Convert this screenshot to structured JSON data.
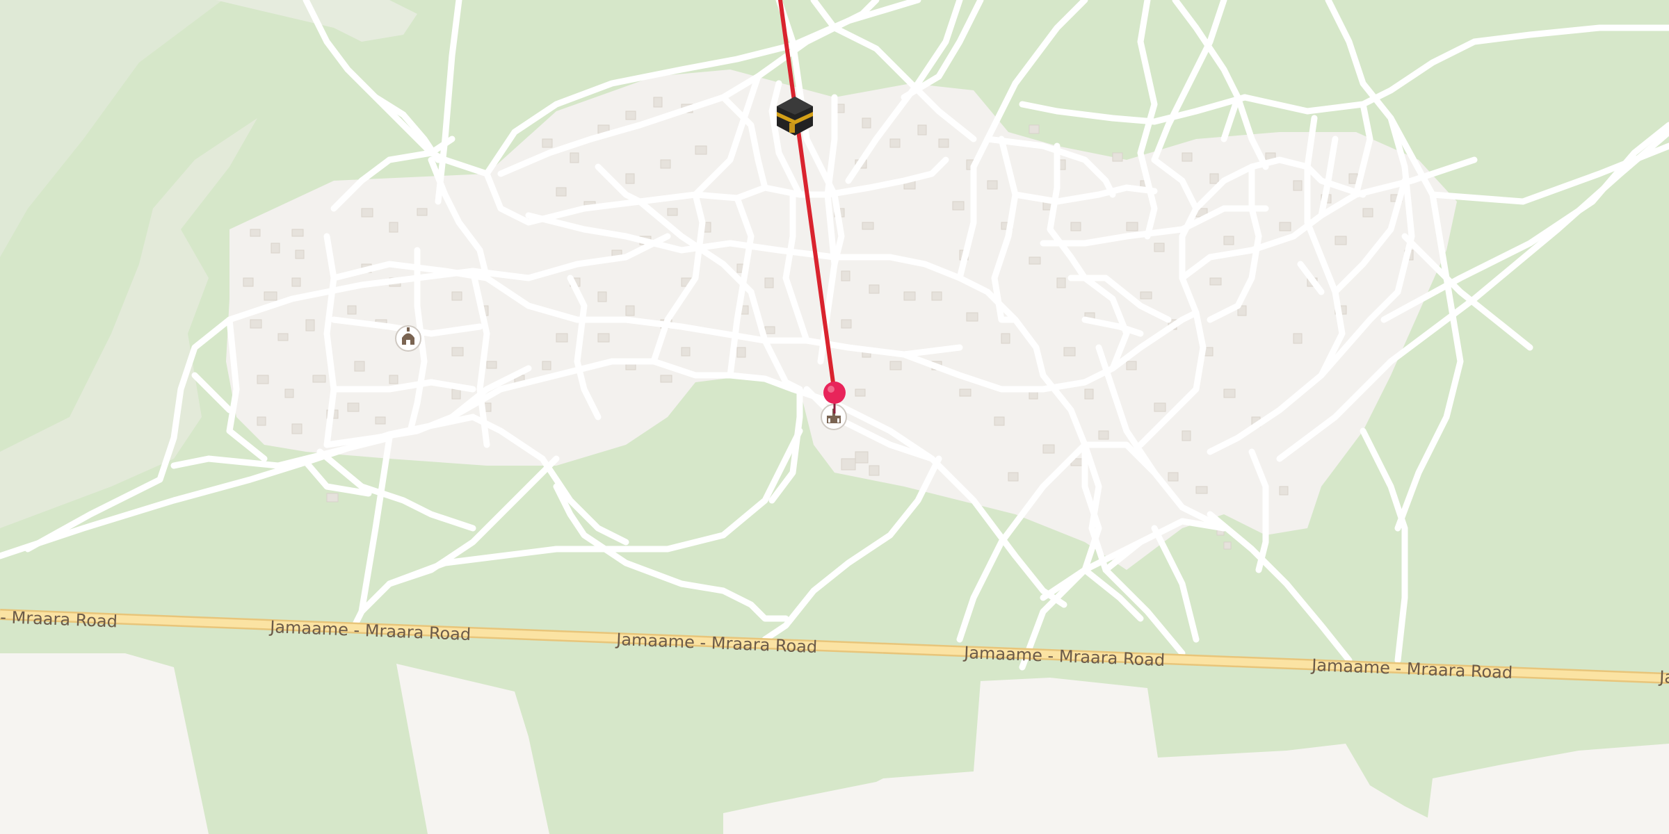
{
  "map": {
    "road_name": "Jamaame - Mraara Road",
    "road_labels": [
      "- Mraara Road",
      "Jamaame - Mraara Road",
      "Jamaame - Mraara Road",
      "Jamaame - Mraara Road",
      "Jamaame - Mraara Road",
      "Ja"
    ],
    "markers": {
      "kaaba": "kaaba-icon",
      "destination_pin": "location-pin-icon",
      "mosque_east": "mosque-icon",
      "mosque_west": "mosque-icon"
    },
    "colors": {
      "land": "#d6e7c9",
      "urban": "#f3f1ee",
      "bare": "#f6f4f1",
      "road_minor": "#ffffff",
      "road_major": "#fbe3a3",
      "qibla_line": "#d9232e",
      "pin": "#e8245a"
    }
  }
}
